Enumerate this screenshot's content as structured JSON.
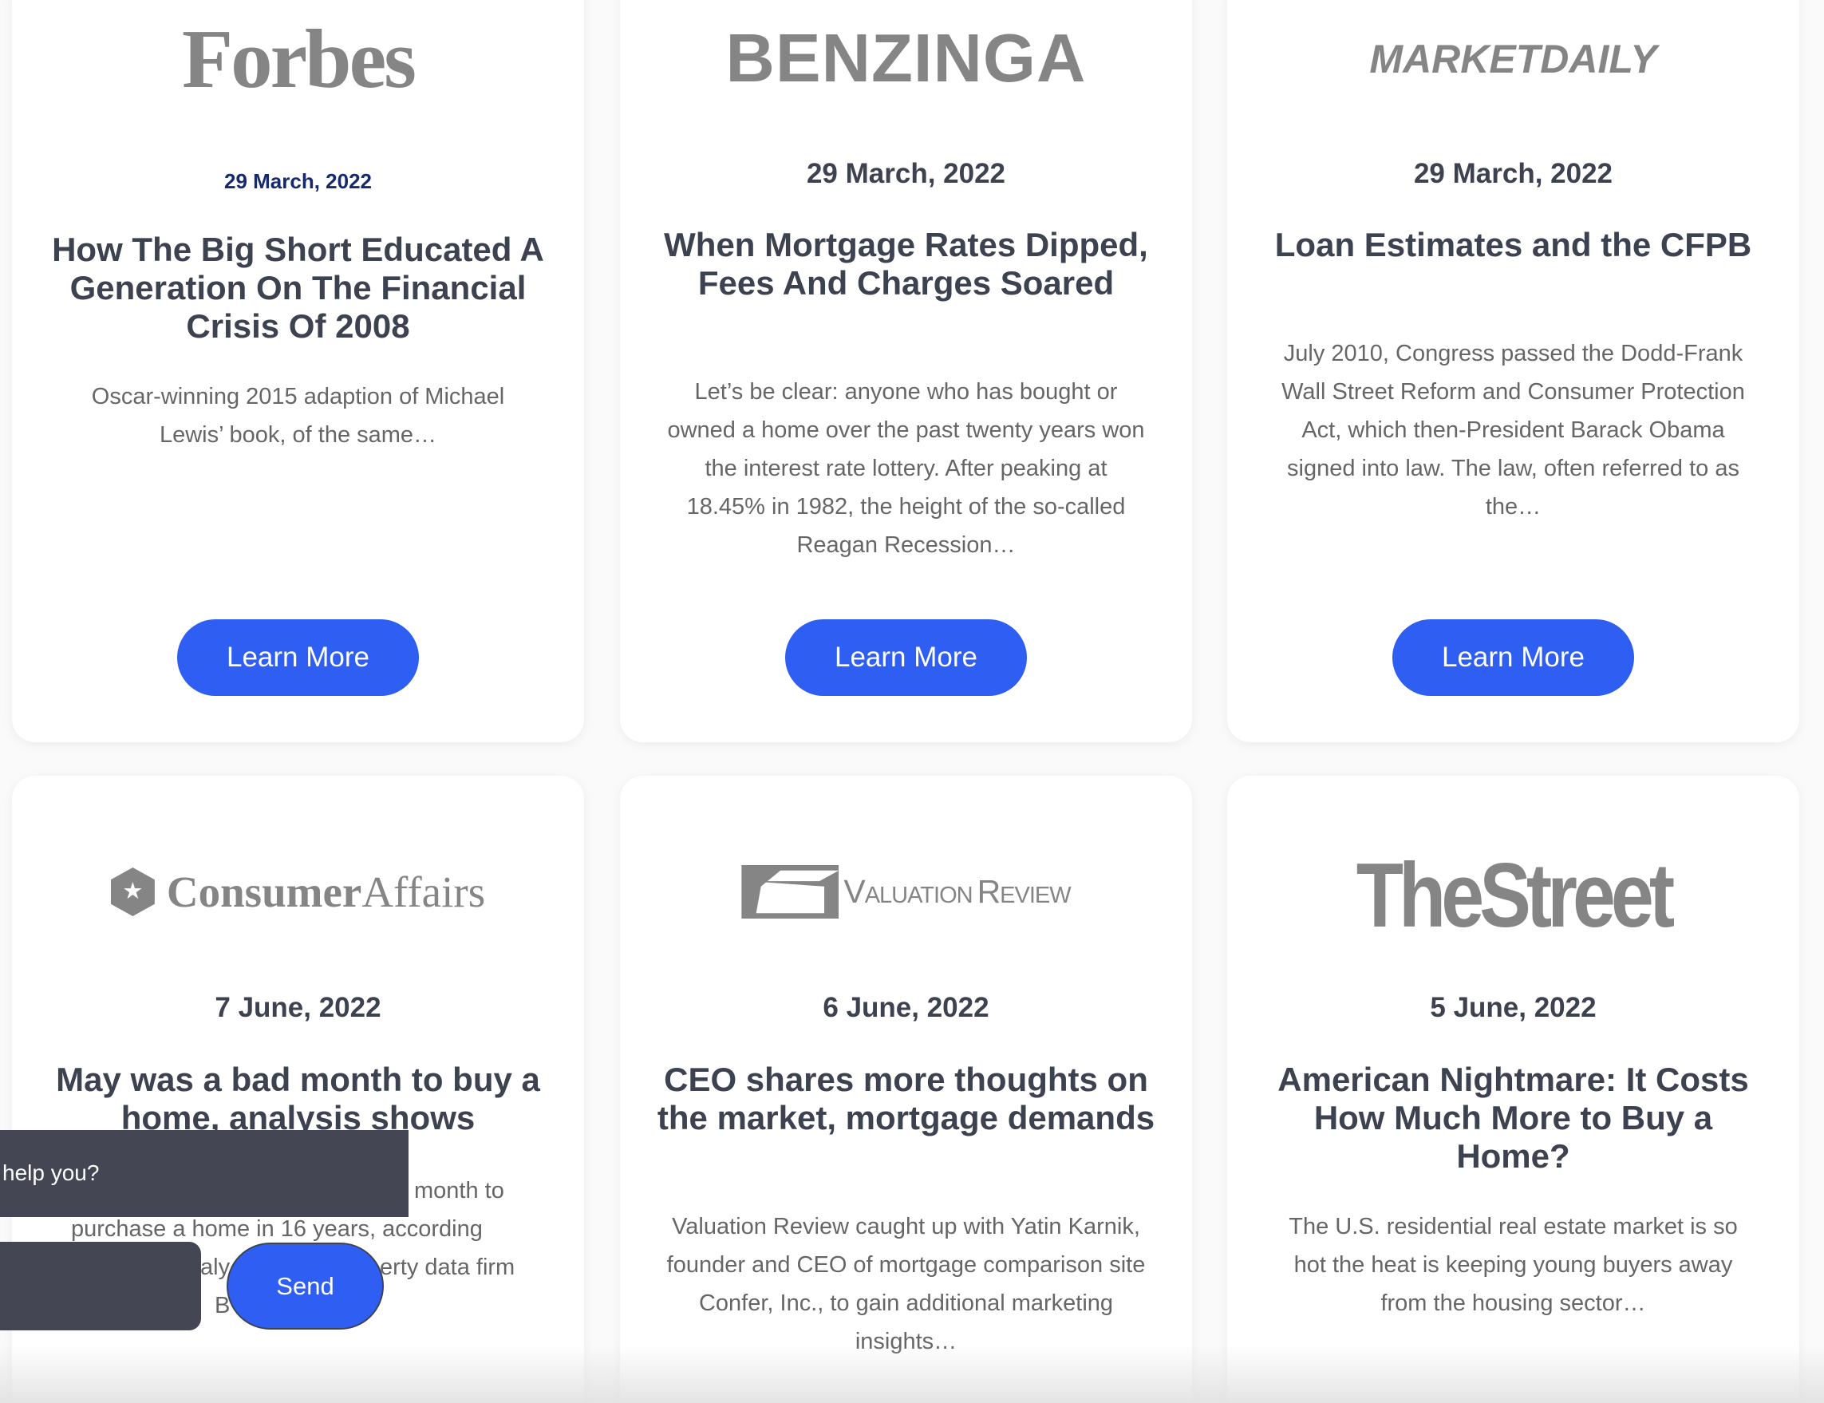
{
  "accent_color": "#2f5ef2",
  "cards": [
    {
      "logo": "Forbes",
      "date": "29 March, 2022",
      "title": "How The Big Short Educated A Generation On The Financial Crisis Of 2008",
      "excerpt": "Oscar-winning 2015 adaption of Michael Lewis’ book, of the same…",
      "button": "Learn More"
    },
    {
      "logo": "BENZINGA",
      "date": "29 March, 2022",
      "title": "When Mortgage Rates Dipped, Fees And Charges Soared",
      "excerpt": "Let’s be clear: anyone who has bought or owned a home over the past twenty years won the interest rate lottery. After peaking at 18.45% in 1982, the height of the so-called Reagan Recession…",
      "button": "Learn More"
    },
    {
      "logo": "MARKETDAILY",
      "date": "29 March, 2022",
      "title": "Loan Estimates and the CFPB",
      "excerpt": "July 2010, Congress passed the Dodd-Frank Wall Street Reform and Consumer Protection Act, which then-President Barack Obama signed into law. The law, often referred to as the…",
      "button": "Learn More"
    },
    {
      "logo_a": "Consumer",
      "logo_b": "Affairs",
      "date": "7 June, 2022",
      "title": "May was a bad month to buy a home, analysis shows",
      "excerpt_fragments": [
        "month to",
        "purchase a home in 16 years, according",
        "aly",
        "erty data firm",
        "B"
      ]
    },
    {
      "logo_a": "Valuation",
      "logo_b": "Review",
      "date": "6 June, 2022",
      "title": "CEO shares more thoughts on the market, mortgage demands",
      "excerpt": "Valuation Review caught up with Yatin Karnik, founder and CEO of mortgage comparison site Confer, Inc., to gain additional marketing insights…"
    },
    {
      "logo": "TheStreet",
      "date": "5 June, 2022",
      "title": "American Nightmare: It Costs How Much More to Buy a Home?",
      "excerpt": "The U.S. residential real estate market is so hot the heat is keeping young buyers away from the housing sector…"
    }
  ],
  "chat": {
    "message": "help you?",
    "send_label": "Send"
  }
}
